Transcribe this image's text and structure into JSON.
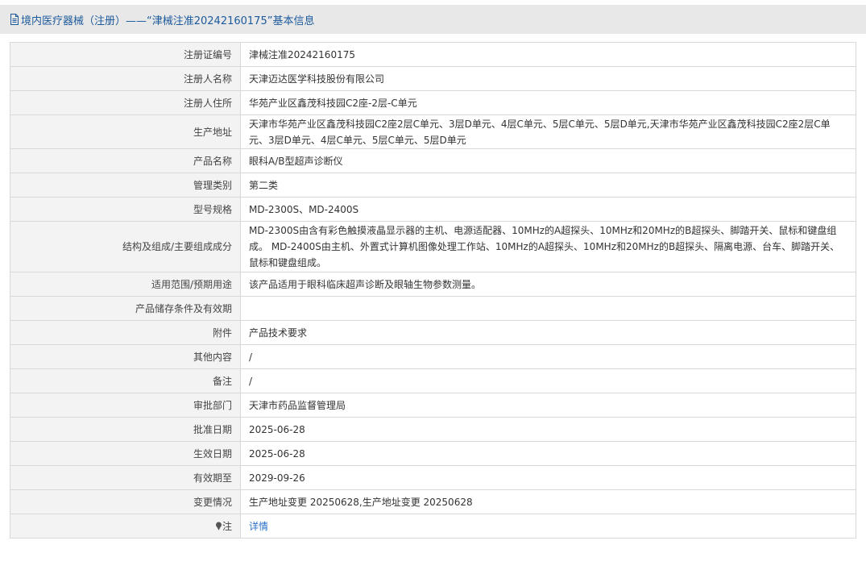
{
  "header": {
    "title": "境内医疗器械（注册）——“津械注准20242160175”基本信息",
    "icon": "document-icon",
    "color": "#1c5a9c"
  },
  "rows": [
    {
      "label": "注册证编号",
      "value": "津械注准20242160175"
    },
    {
      "label": "注册人名称",
      "value": "天津迈达医学科技股份有限公司"
    },
    {
      "label": "注册人住所",
      "value": "华苑产业区鑫茂科技园C2座-2层-C单元"
    },
    {
      "label": "生产地址",
      "value": "天津市华苑产业区鑫茂科技园C2座2层C单元、3层D单元、4层C单元、5层C单元、5层D单元,天津市华苑产业区鑫茂科技园C2座2层C单元、3层D单元、4层C单元、5层C单元、5层D单元"
    },
    {
      "label": "产品名称",
      "value": "眼科A/B型超声诊断仪"
    },
    {
      "label": "管理类别",
      "value": "第二类"
    },
    {
      "label": "型号规格",
      "value": "MD-2300S、MD-2400S"
    },
    {
      "label": "结构及组成/主要组成成分",
      "value": "MD-2300S由含有彩色触摸液晶显示器的主机、电源适配器、10MHz的A超探头、10MHz和20MHz的B超探头、脚踏开关、鼠标和键盘组成。 MD-2400S由主机、外置式计算机图像处理工作站、10MHz的A超探头、10MHz和20MHz的B超探头、隔离电源、台车、脚踏开关、鼠标和键盘组成。"
    },
    {
      "label": "适用范围/预期用途",
      "value": "该产品适用于眼科临床超声诊断及眼轴生物参数测量。"
    },
    {
      "label": "产品储存条件及有效期",
      "value": ""
    },
    {
      "label": "附件",
      "value": "产品技术要求"
    },
    {
      "label": "其他内容",
      "value": "/"
    },
    {
      "label": "备注",
      "value": "/"
    },
    {
      "label": "审批部门",
      "value": "天津市药品监督管理局"
    },
    {
      "label": "批准日期",
      "value": "2025-06-28"
    },
    {
      "label": "生效日期",
      "value": "2025-06-28"
    },
    {
      "label": "有效期至",
      "value": "2029-09-26"
    },
    {
      "label": "变更情况",
      "value": "生产地址变更 20250628,生产地址变更 20250628"
    }
  ],
  "note": {
    "label": "注",
    "icon": "pin-icon",
    "link_text": "详情",
    "link_color": "#2a6fc9"
  }
}
